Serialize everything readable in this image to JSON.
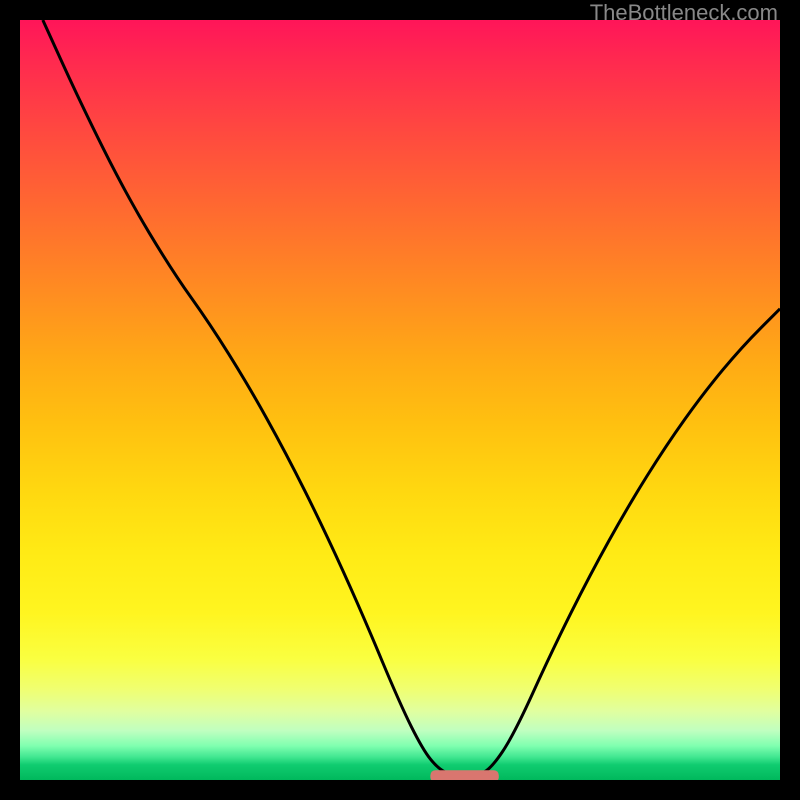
{
  "watermark": "TheBottleneck.com",
  "chart_data": {
    "type": "line",
    "title": "",
    "xlabel": "",
    "ylabel": "",
    "xlim": [
      0,
      100
    ],
    "ylim": [
      0,
      100
    ],
    "curve_points": [
      {
        "x": 3,
        "y": 100
      },
      {
        "x": 8,
        "y": 89
      },
      {
        "x": 14,
        "y": 77
      },
      {
        "x": 20,
        "y": 67
      },
      {
        "x": 25,
        "y": 60
      },
      {
        "x": 30,
        "y": 52
      },
      {
        "x": 35,
        "y": 43
      },
      {
        "x": 40,
        "y": 33
      },
      {
        "x": 45,
        "y": 22
      },
      {
        "x": 50,
        "y": 10
      },
      {
        "x": 53,
        "y": 4
      },
      {
        "x": 55,
        "y": 1.5
      },
      {
        "x": 57,
        "y": 0.5
      },
      {
        "x": 60,
        "y": 0.5
      },
      {
        "x": 62,
        "y": 1.5
      },
      {
        "x": 65,
        "y": 6
      },
      {
        "x": 70,
        "y": 17
      },
      {
        "x": 75,
        "y": 27
      },
      {
        "x": 80,
        "y": 36
      },
      {
        "x": 85,
        "y": 44
      },
      {
        "x": 90,
        "y": 51
      },
      {
        "x": 95,
        "y": 57
      },
      {
        "x": 100,
        "y": 62
      }
    ],
    "marker": {
      "x_start": 54,
      "x_end": 63,
      "y": 0.5,
      "color": "#d9766f"
    }
  }
}
